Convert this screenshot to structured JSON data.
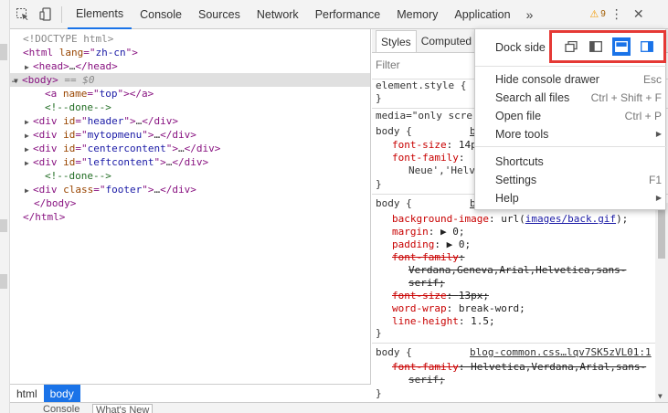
{
  "toolbar": {
    "tabs": [
      {
        "label": "Elements",
        "active": true
      },
      {
        "label": "Console"
      },
      {
        "label": "Sources"
      },
      {
        "label": "Network"
      },
      {
        "label": "Performance"
      },
      {
        "label": "Memory"
      },
      {
        "label": "Application"
      }
    ],
    "more_tabs": "»",
    "warning_count": "9"
  },
  "dom": {
    "lines": [
      {
        "parts": [
          {
            "t": "<!DOCTYPE html>",
            "c": "cmt-gray"
          }
        ]
      },
      {
        "parts": [
          {
            "t": "<html ",
            "c": "tag"
          },
          {
            "t": "lang",
            "c": "attr"
          },
          {
            "t": "=\"",
            "c": "tag"
          },
          {
            "t": "zh-cn",
            "c": "val"
          },
          {
            "t": "\">",
            "c": "tag"
          }
        ]
      },
      {
        "parts": [
          {
            "t": "<head>",
            "c": "tag"
          },
          {
            "t": "…",
            "c": "plain"
          },
          {
            "t": "</head>",
            "c": "tag"
          }
        ]
      },
      {
        "parts": [
          {
            "t": "<body>",
            "c": "tag"
          },
          {
            "t": " == $0",
            "c": "eqs"
          }
        ]
      },
      {
        "parts": [
          {
            "t": "<a ",
            "c": "tag"
          },
          {
            "t": "name",
            "c": "attr"
          },
          {
            "t": "=\"",
            "c": "tag"
          },
          {
            "t": "top",
            "c": "val"
          },
          {
            "t": "\"></a>",
            "c": "tag"
          }
        ]
      },
      {
        "parts": [
          {
            "t": "<!--done-->",
            "c": "cmt"
          }
        ]
      },
      {
        "parts": [
          {
            "t": "<div ",
            "c": "tag"
          },
          {
            "t": "id",
            "c": "attr"
          },
          {
            "t": "=\"",
            "c": "tag"
          },
          {
            "t": "header",
            "c": "val"
          },
          {
            "t": "\">",
            "c": "tag"
          },
          {
            "t": "…",
            "c": "plain"
          },
          {
            "t": "</div>",
            "c": "tag"
          }
        ]
      },
      {
        "parts": [
          {
            "t": "<div ",
            "c": "tag"
          },
          {
            "t": "id",
            "c": "attr"
          },
          {
            "t": "=\"",
            "c": "tag"
          },
          {
            "t": "mytopmenu",
            "c": "val"
          },
          {
            "t": "\">",
            "c": "tag"
          },
          {
            "t": "…",
            "c": "plain"
          },
          {
            "t": "</div>",
            "c": "tag"
          }
        ]
      },
      {
        "parts": [
          {
            "t": "<div ",
            "c": "tag"
          },
          {
            "t": "id",
            "c": "attr"
          },
          {
            "t": "=\"",
            "c": "tag"
          },
          {
            "t": "centercontent",
            "c": "val"
          },
          {
            "t": "\">",
            "c": "tag"
          },
          {
            "t": "…",
            "c": "plain"
          },
          {
            "t": "</div>",
            "c": "tag"
          }
        ]
      },
      {
        "parts": [
          {
            "t": "<div ",
            "c": "tag"
          },
          {
            "t": "id",
            "c": "attr"
          },
          {
            "t": "=\"",
            "c": "tag"
          },
          {
            "t": "leftcontent",
            "c": "val"
          },
          {
            "t": "\">",
            "c": "tag"
          },
          {
            "t": "…",
            "c": "plain"
          },
          {
            "t": "</div>",
            "c": "tag"
          }
        ]
      },
      {
        "parts": [
          {
            "t": "<!--done-->",
            "c": "cmt"
          }
        ]
      },
      {
        "parts": [
          {
            "t": "<div ",
            "c": "tag"
          },
          {
            "t": "class",
            "c": "attr"
          },
          {
            "t": "=\"",
            "c": "tag"
          },
          {
            "t": "footer",
            "c": "val"
          },
          {
            "t": "\">",
            "c": "tag"
          },
          {
            "t": "…",
            "c": "plain"
          },
          {
            "t": "</div>",
            "c": "tag"
          }
        ]
      },
      {
        "parts": [
          {
            "t": "</body>",
            "c": "tag"
          }
        ]
      },
      {
        "parts": [
          {
            "t": "</html>",
            "c": "tag"
          }
        ]
      }
    ],
    "dots": "…"
  },
  "breadcrumbs": [
    "html",
    "body"
  ],
  "drawer": {
    "tab1": "Console",
    "tab2": "What's New"
  },
  "styles": {
    "tabs": [
      "Styles",
      "Computed"
    ],
    "filter_placeholder": "Filter",
    "element_style": "element.style {",
    "close_brace": "}",
    "media": "media=\"only scre",
    "rule1": {
      "selector": "body {",
      "src": "b",
      "p1": "font-size",
      "v1": "14p",
      "p2": "font-family",
      "v2": "",
      "v2b": "Neue','Helv"
    },
    "rule2": {
      "selector": "body {",
      "src": "b",
      "props": [
        {
          "p": "background-image",
          "v": "url(",
          "link": "images/back.gif",
          "v2": ");"
        },
        {
          "p": "margin",
          "v": "▶ 0;"
        },
        {
          "p": "padding",
          "v": "▶ 0;"
        },
        {
          "p": "font-family",
          "v": "",
          "strike": true
        },
        {
          "p": "",
          "v": "Verdana,Geneva,Arial,Helvetica,sans-",
          "strike": true
        },
        {
          "p": "",
          "v": "serif;",
          "strike": true
        },
        {
          "p": "font-size",
          "v": "13px;",
          "strike": true
        },
        {
          "p": "word-wrap",
          "v": "break-word;"
        },
        {
          "p": "line-height",
          "v": "1.5;"
        }
      ]
    },
    "rule3": {
      "selector": "body {",
      "src": "blog-common.css…lqv7SK5zVL01:1",
      "p": "font-family",
      "v": "Helvetica,Verdana,Arial,sans-",
      "v2": "serif;"
    }
  },
  "menu": {
    "dock_side_label": "Dock side",
    "dock_options": [
      {
        "name": "undock-icon"
      },
      {
        "name": "dock-left-icon"
      },
      {
        "name": "dock-bottom-icon",
        "active": true
      },
      {
        "name": "dock-right-icon"
      }
    ],
    "items": [
      {
        "label": "Hide console drawer",
        "shortcut": "Esc"
      },
      {
        "label": "Search all files",
        "shortcut": "Ctrl + Shift + F"
      },
      {
        "label": "Open file",
        "shortcut": "Ctrl + P"
      },
      {
        "label": "More tools",
        "submenu": true
      },
      {
        "label": "Shortcuts",
        "shortcut": ""
      },
      {
        "label": "Settings",
        "shortcut": "F1"
      },
      {
        "label": "Help",
        "submenu": true
      }
    ]
  },
  "colors": {
    "accent": "#1a73e8",
    "highlight_box": "#e53935",
    "warning": "#f29900"
  }
}
